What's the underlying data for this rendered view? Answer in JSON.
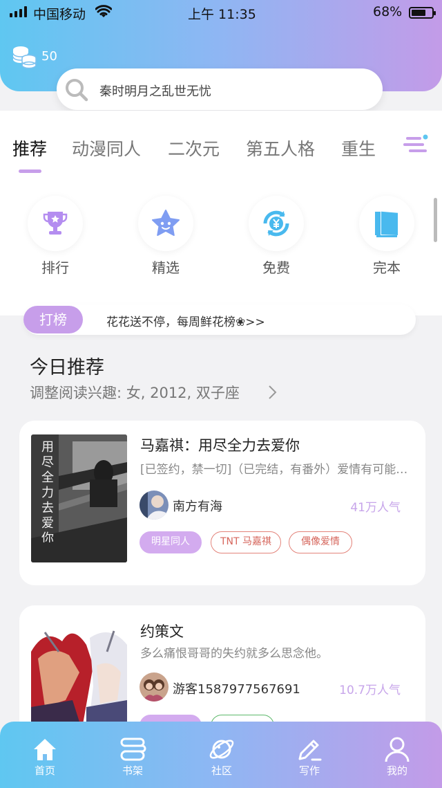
{
  "status_bar": {
    "carrier": "中国移动",
    "time": "上午 11:35",
    "battery": "68%"
  },
  "header": {
    "coin_count": "50",
    "search_placeholder": "秦时明月之乱世无忧"
  },
  "tabs": [
    "推荐",
    "动漫同人",
    "二次元",
    "第五人格",
    "重生"
  ],
  "quick_links": [
    {
      "label": "排行",
      "icon": "trophy-icon"
    },
    {
      "label": "精选",
      "icon": "star-icon"
    },
    {
      "label": "免费",
      "icon": "yen-refresh-icon"
    },
    {
      "label": "完本",
      "icon": "book-icon"
    }
  ],
  "hot_strip": {
    "badge": "打榜",
    "text": "花花送不停，每周鲜花榜❀>>"
  },
  "section": {
    "title": "今日推荐",
    "subtitle": "调整阅读兴趣: 女, 2012, 双子座"
  },
  "books": [
    {
      "title": "马嘉祺：用尽全力去爱你",
      "desc": "[已签约，禁一切]（已完结，有番外）爱情有可能的话，我想和你在一起",
      "author": "南方有海",
      "popularity": "41万人气",
      "tags": [
        "明星同人",
        "TNT 马嘉祺",
        "偶像爱情"
      ],
      "cover_text": "用尽全力去爱你"
    },
    {
      "title": "约策文",
      "desc": "多么痛恨哥哥的失约就多么思念他。",
      "author": "游客1587977567691",
      "popularity": "10.7万人气",
      "tags": [
        "",
        ""
      ]
    }
  ],
  "bottom_nav": [
    {
      "label": "首页",
      "icon": "home-icon"
    },
    {
      "label": "书架",
      "icon": "bookshelf-icon"
    },
    {
      "label": "社区",
      "icon": "planet-icon"
    },
    {
      "label": "写作",
      "icon": "pen-icon"
    },
    {
      "label": "我的",
      "icon": "user-icon"
    }
  ],
  "colors": {
    "accent_purple": "#c79eea",
    "gradient_start": "#5fc7f1",
    "gradient_end": "#c39be8"
  }
}
